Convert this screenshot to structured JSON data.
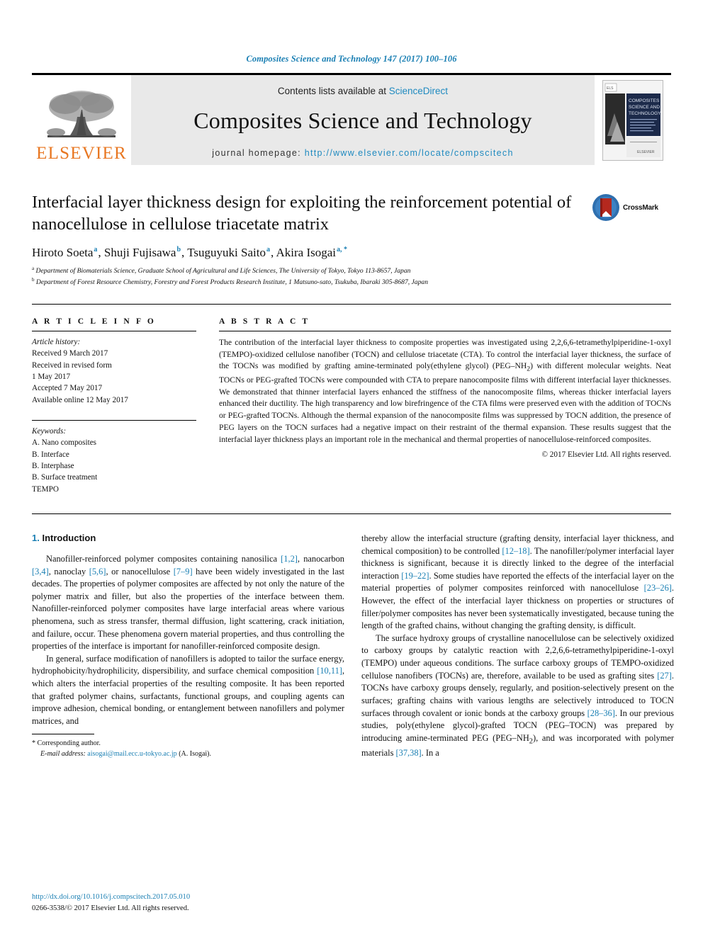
{
  "running_head": "Composites Science and Technology 147 (2017) 100–106",
  "masthead": {
    "publisher_name": "ELSEVIER",
    "contents_prefix": "Contents lists available at",
    "contents_link": "ScienceDirect",
    "journal_name": "Composites Science and Technology",
    "homepage_label": "journal homepage:",
    "homepage_url": "http://www.elsevier.com/locate/compscitech",
    "cover_title_line1": "COMPOSITES",
    "cover_title_line2": "SCIENCE AND",
    "cover_title_line3": "TECHNOLOGY",
    "cover_publisher": "ELSEVIER"
  },
  "article": {
    "title": "Interfacial layer thickness design for exploiting the reinforcement potential of nanocellulose in cellulose triacetate matrix",
    "crossmark_label": "CrossMark",
    "authors": [
      {
        "name": "Hiroto Soeta",
        "marks": "a"
      },
      {
        "name": "Shuji Fujisawa",
        "marks": "b"
      },
      {
        "name": "Tsuguyuki Saito",
        "marks": "a"
      },
      {
        "name": "Akira Isogai",
        "marks": "a, *"
      }
    ],
    "affiliations": [
      {
        "mark": "a",
        "text": "Department of Biomaterials Science, Graduate School of Agricultural and Life Sciences, The University of Tokyo, Tokyo 113-8657, Japan"
      },
      {
        "mark": "b",
        "text": "Department of Forest Resource Chemistry, Forestry and Forest Products Research Institute, 1 Matsuno-sato, Tsukuba, Ibaraki 305-8687, Japan"
      }
    ]
  },
  "article_info": {
    "heading": "A R T I C L E   I N F O",
    "history_label": "Article history:",
    "history": [
      "Received 9 March 2017",
      "Received in revised form",
      "1 May 2017",
      "Accepted 7 May 2017",
      "Available online 12 May 2017"
    ],
    "keywords_label": "Keywords:",
    "keywords": [
      "A. Nano composites",
      "B. Interface",
      "B. Interphase",
      "B. Surface treatment",
      "TEMPO"
    ]
  },
  "abstract": {
    "heading": "A B S T R A C T",
    "text": "The contribution of the interfacial layer thickness to composite properties was investigated using 2,2,6,6-tetramethylpiperidine-1-oxyl (TEMPO)-oxidized cellulose nanofiber (TOCN) and cellulose triacetate (CTA). To control the interfacial layer thickness, the surface of the TOCNs was modified by grafting amine-terminated poly(ethylene glycol) (PEG–NH2) with different molecular weights. Neat TOCNs or PEG-grafted TOCNs were compounded with CTA to prepare nanocomposite films with different interfacial layer thicknesses. We demonstrated that thinner interfacial layers enhanced the stiffness of the nanocomposite films, whereas thicker interfacial layers enhanced their ductility. The high transparency and low birefringence of the CTA films were preserved even with the addition of TOCNs or PEG-grafted TOCNs. Although the thermal expansion of the nanocomposite films was suppressed by TOCN addition, the presence of PEG layers on the TOCN surfaces had a negative impact on their restraint of the thermal expansion. These results suggest that the interfacial layer thickness plays an important role in the mechanical and thermal properties of nanocellulose-reinforced composites.",
    "copyright": "© 2017 Elsevier Ltd. All rights reserved."
  },
  "introduction": {
    "number": "1.",
    "title": "Introduction",
    "left_paragraphs": [
      "Nanofiller-reinforced polymer composites containing nanosilica [1,2], nanocarbon [3,4], nanoclay [5,6], or nanocellulose [7–9] have been widely investigated in the last decades. The properties of polymer composites are affected by not only the nature of the polymer matrix and filler, but also the properties of the interface between them. Nanofiller-reinforced polymer composites have large interfacial areas where various phenomena, such as stress transfer, thermal diffusion, light scattering, crack initiation, and failure, occur. These phenomena govern material properties, and thus controlling the properties of the interface is important for nanofiller-reinforced composite design.",
      "In general, surface modification of nanofillers is adopted to tailor the surface energy, hydrophobicity/hydrophilicity, dispersibility, and surface chemical composition [10,11], which alters the interfacial properties of the resulting composite. It has been reported that grafted polymer chains, surfactants, functional groups, and coupling agents can improve adhesion, chemical bonding, or entanglement between nanofillers and polymer matrices, and"
    ],
    "right_paragraphs": [
      "thereby allow the interfacial structure (grafting density, interfacial layer thickness, and chemical composition) to be controlled [12–18]. The nanofiller/polymer interfacial layer thickness is significant, because it is directly linked to the degree of the interfacial interaction [19–22]. Some studies have reported the effects of the interfacial layer on the material properties of polymer composites reinforced with nanocellulose [23–26]. However, the effect of the interfacial layer thickness on properties or structures of filler/polymer composites has never been systematically investigated, because tuning the length of the grafted chains, without changing the grafting density, is difficult.",
      "The surface hydroxy groups of crystalline nanocellulose can be selectively oxidized to carboxy groups by catalytic reaction with 2,2,6,6-tetramethylpiperidine-1-oxyl (TEMPO) under aqueous conditions. The surface carboxy groups of TEMPO-oxidized cellulose nanofibers (TOCNs) are, therefore, available to be used as grafting sites [27]. TOCNs have carboxy groups densely, regularly, and position-selectively present on the surfaces; grafting chains with various lengths are selectively introduced to TOCN surfaces through covalent or ionic bonds at the carboxy groups [28–36]. In our previous studies, poly(ethylene glycol)-grafted TOCN (PEG–TOCN) was prepared by introducing amine-terminated PEG (PEG–NH2), and was incorporated with polymer materials [37,38]. In a"
    ]
  },
  "footnote": {
    "corresponding_marker": "*",
    "corresponding_label": "Corresponding author.",
    "email_label": "E-mail address:",
    "email": "aisogai@mail.ecc.u-tokyo.ac.jp",
    "email_owner": "(A. Isogai)."
  },
  "page_footer": {
    "doi": "http://dx.doi.org/10.1016/j.compscitech.2017.05.010",
    "issn_line": "0266-3538/© 2017 Elsevier Ltd. All rights reserved."
  },
  "colors": {
    "link_blue": "#1a7fb3",
    "elsevier_orange": "#E87722",
    "masthead_grey": "#e9e9e9"
  }
}
